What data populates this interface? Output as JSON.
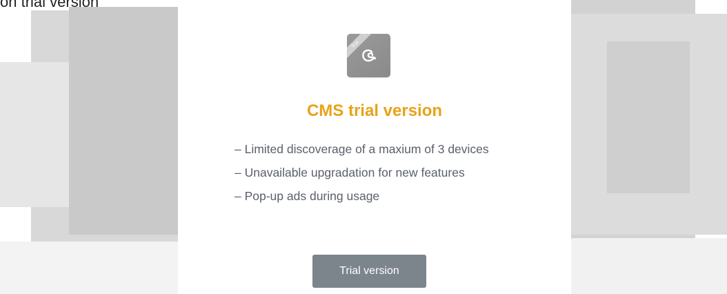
{
  "caption": "on trial version",
  "card": {
    "logo_ribbon": "Trial",
    "title": "CMS trial version",
    "features": [
      "– Limited discoverage of a maxium of 3 devices",
      "– Unavailable upgradation for new features",
      "– Pop-up ads during usage"
    ],
    "button_label": "Trial version"
  },
  "colors": {
    "title": "#e8a21a",
    "button": "#7c848c",
    "text": "#5a5f6b"
  }
}
